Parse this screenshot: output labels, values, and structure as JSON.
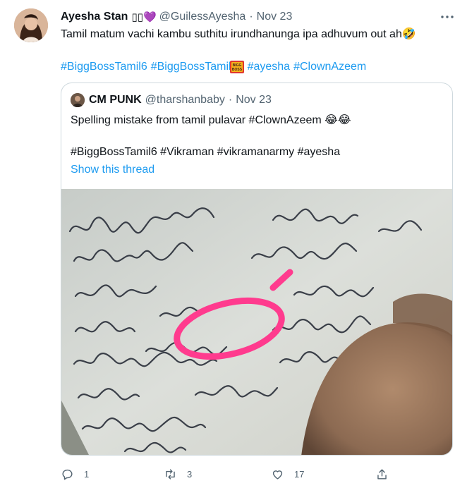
{
  "tweet": {
    "author_name": "Ayesha Stan",
    "author_badge": "▯▯💜",
    "handle": "@GuilessAyesha",
    "separator": "·",
    "date": "Nov 23",
    "text": "Tamil matum vachi kambu suthitu irundhanunga ipa adhuvum out ah🤣",
    "hashtags": [
      "#BiggBossTamil6",
      "#BiggBossTamil",
      "#ayesha",
      "#ClownAzeem"
    ],
    "hashtag_emoji_label": "BIGG BOSS"
  },
  "quoted": {
    "author_name": "CM PUNK",
    "handle": "@tharshanbaby",
    "separator": "·",
    "date": "Nov 23",
    "text": "Spelling mistake from tamil pulavar #ClownAzeem 😂😂",
    "hashtags_line": "#BiggBossTamil6 #Vikraman #vikramanarmy #ayesha",
    "show_thread": "Show this thread"
  },
  "actions": {
    "reply_count": "1",
    "retweet_count": "3",
    "like_count": "17",
    "share_count": ""
  },
  "colors": {
    "accent": "#1d9bf0",
    "muted": "#536471",
    "border": "#cfd9de",
    "highlight_circle": "#ff3b8e"
  },
  "icons": {
    "more": "more-icon",
    "reply": "reply-icon",
    "retweet": "retweet-icon",
    "like": "heart-icon",
    "share": "share-icon"
  }
}
